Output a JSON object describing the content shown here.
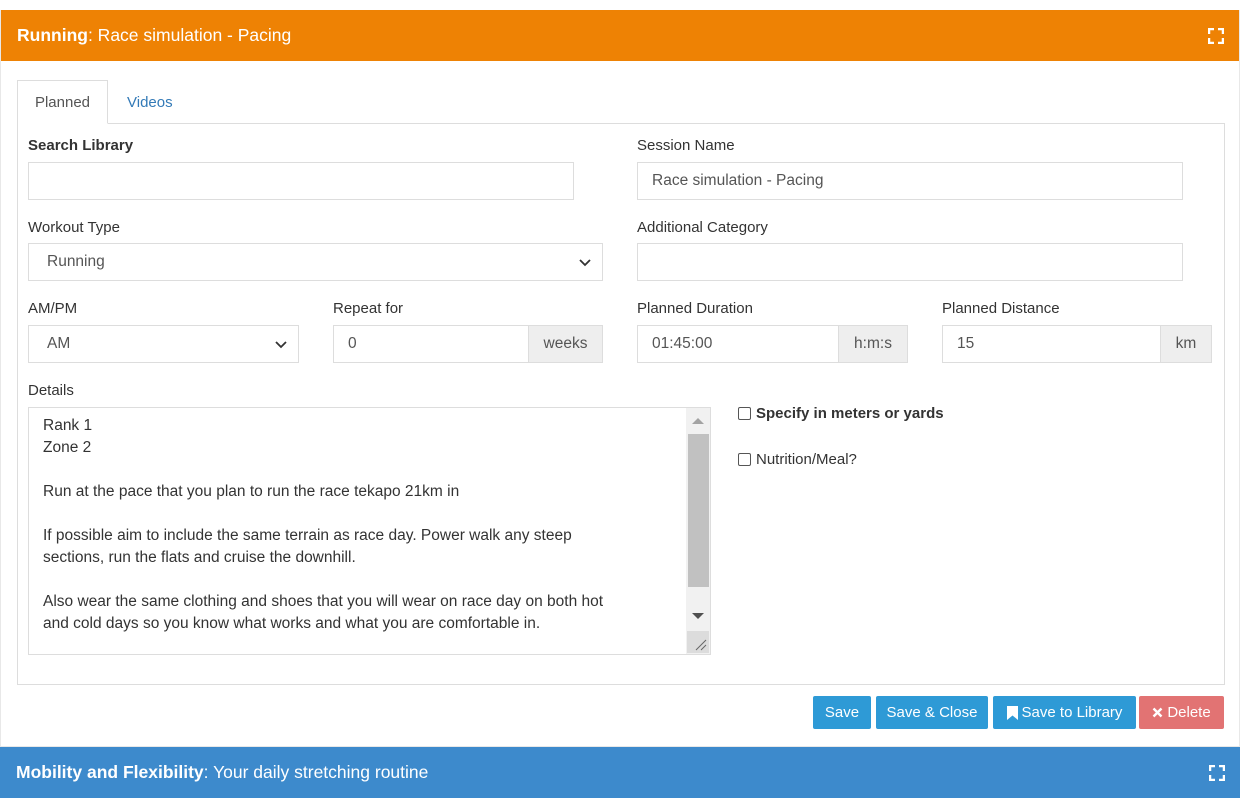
{
  "running_panel": {
    "title_bold": "Running",
    "title_rest": ": Race simulation - Pacing",
    "colors": {
      "header": "#ee8204"
    }
  },
  "tabs": [
    {
      "label": "Planned",
      "active": true
    },
    {
      "label": "Videos",
      "active": false
    }
  ],
  "form": {
    "search_library": {
      "label": "Search Library",
      "value": ""
    },
    "session_name": {
      "label": "Session Name",
      "value": "Race simulation - Pacing"
    },
    "workout_type": {
      "label": "Workout Type",
      "value": "Running"
    },
    "additional_category": {
      "label": "Additional Category",
      "value": ""
    },
    "ampm": {
      "label": "AM/PM",
      "value": "AM"
    },
    "repeat_for": {
      "label": "Repeat for",
      "value": "0",
      "unit": "weeks"
    },
    "planned_duration": {
      "label": "Planned Duration",
      "value": "01:45:00",
      "unit": "h:m:s"
    },
    "planned_distance": {
      "label": "Planned Distance",
      "value": "15",
      "unit": "km"
    },
    "details": {
      "label": "Details",
      "lines": [
        "Rank 1",
        "Zone 2",
        "",
        "Run at the pace that you plan to run the race tekapo 21km in",
        "",
        "If possible aim to include the same terrain as race day.  Power walk any steep",
        "sections, run the flats and cruise the downhill.",
        "",
        "Also wear the same clothing and shoes that you will wear on race day on both hot",
        "and cold days so you know what works and what you are comfortable in."
      ]
    },
    "specify_meters": {
      "label": "Specify in meters or yards",
      "checked": false
    },
    "nutrition": {
      "label": "Nutrition/Meal?",
      "checked": false
    }
  },
  "buttons": {
    "save": "Save",
    "save_close": "Save & Close",
    "save_library": "Save to Library",
    "delete": "Delete"
  },
  "mobility_panel": {
    "title_bold": "Mobility and Flexibility",
    "title_rest": ": Your daily stretching routine",
    "colors": {
      "header": "#3d8acc"
    }
  },
  "icons": {
    "expand": "expand-icon",
    "chevron": "chevron-down-icon",
    "bookmark": "bookmark-icon",
    "close": "close-icon"
  }
}
